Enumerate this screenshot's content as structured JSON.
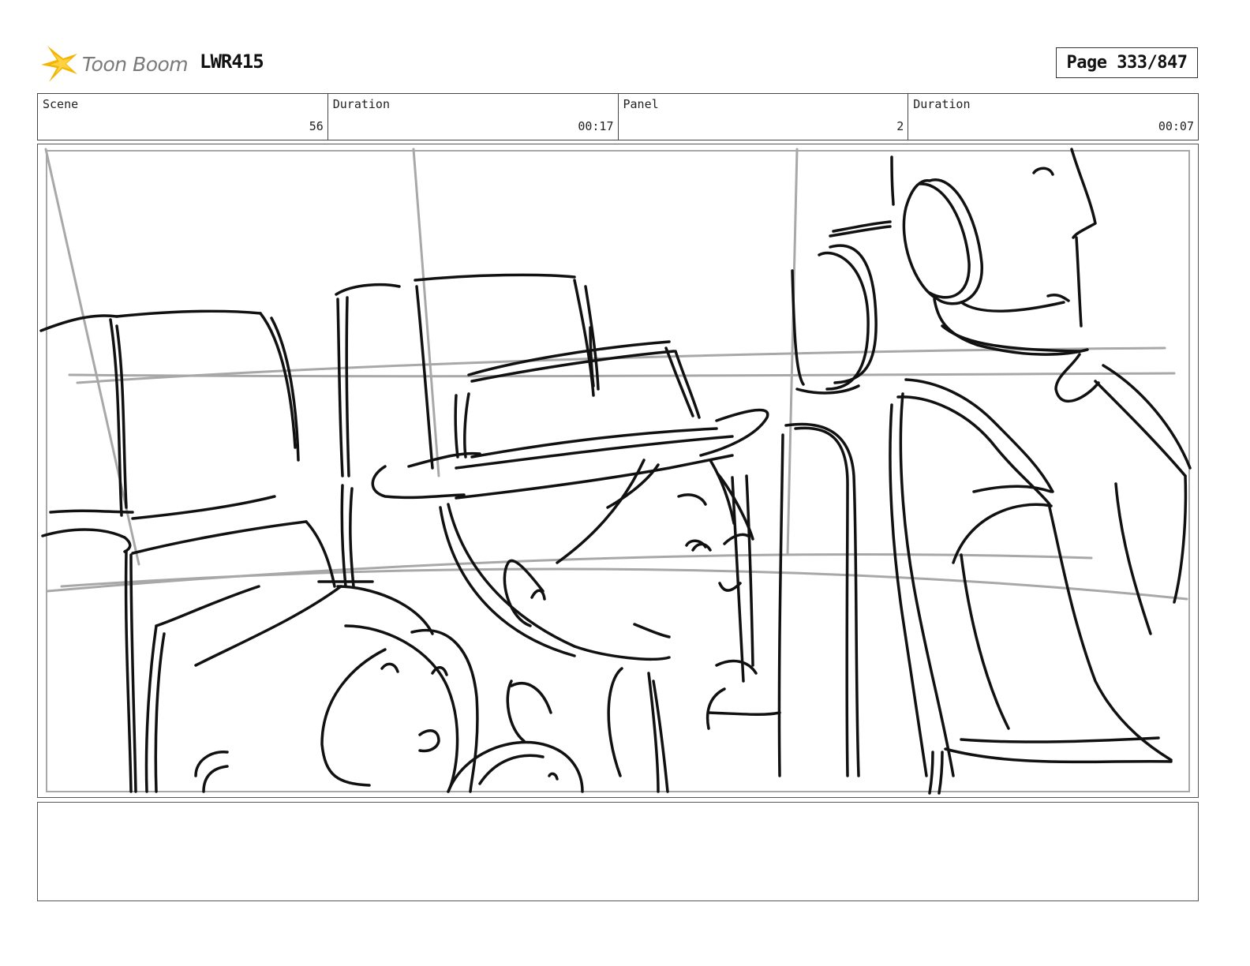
{
  "header": {
    "logo_text": "Toon Boom",
    "project_code": "LWR415",
    "page": "Page 333/847"
  },
  "info": {
    "scene_label": "Scene",
    "scene_value": "56",
    "scene_duration_label": "Duration",
    "scene_duration_value": "00:17",
    "panel_label": "Panel",
    "panel_value": "2",
    "panel_duration_label": "Duration",
    "panel_duration_value": "00:07"
  },
  "notes": {
    "text": ""
  },
  "colors": {
    "logo_yellow": "#f5b400",
    "logo_text": "#7a7a7a",
    "sketch_line": "#111111",
    "guide_line": "#a8a8a8"
  }
}
